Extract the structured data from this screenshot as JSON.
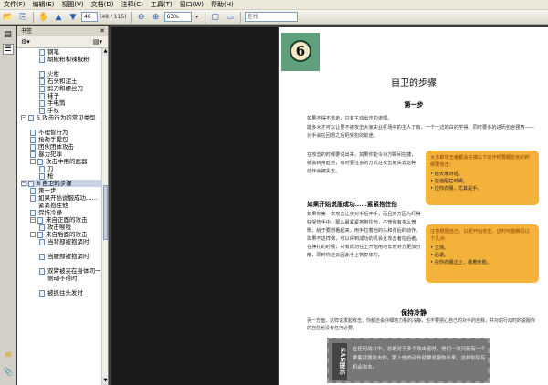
{
  "menubar": {
    "items": [
      "文件(F)",
      "编辑(E)",
      "视图(V)",
      "文档(D)",
      "注释(C)",
      "工具(T)",
      "窗口(W)",
      "帮助(H)"
    ]
  },
  "toolbar": {
    "page_value": "46",
    "page_total": "(48 / 115)",
    "zoom_value": "63%",
    "search_placeholder": "查找"
  },
  "panel": {
    "title": "书签",
    "items": [
      {
        "label": "钢笔",
        "level": 3,
        "expander": ""
      },
      {
        "label": "胡椒粉和辣椒粉",
        "level": 3,
        "expander": ""
      },
      {
        "label": "火柑",
        "level": 3,
        "expander": ""
      },
      {
        "label": "石头和泥土",
        "level": 3,
        "expander": ""
      },
      {
        "label": "剪刀和螺丝刀",
        "level": 3,
        "expander": ""
      },
      {
        "label": "袜子",
        "level": 3,
        "expander": ""
      },
      {
        "label": "手电筒",
        "level": 3,
        "expander": ""
      },
      {
        "label": "手杖",
        "level": 3,
        "expander": ""
      },
      {
        "label": "5 攻击行为的常见类型",
        "level": 1,
        "expander": "−"
      },
      {
        "label": "不理智行为",
        "level": 2,
        "expander": ""
      },
      {
        "label": "抢劫手提包",
        "level": 2,
        "expander": ""
      },
      {
        "label": "团伙团体攻击",
        "level": 2,
        "expander": ""
      },
      {
        "label": "暴力犯罪",
        "level": 2,
        "expander": ""
      },
      {
        "label": "攻击中用的武器",
        "level": 2,
        "expander": "−"
      },
      {
        "label": "刀",
        "level": 3,
        "expander": ""
      },
      {
        "label": "枪",
        "level": 3,
        "expander": ""
      },
      {
        "label": "6 自卫的步骤",
        "level": 1,
        "expander": "−"
      },
      {
        "label": "第一步",
        "level": 2,
        "expander": ""
      },
      {
        "label": "如果开始说服成功……紧紧抱住他",
        "level": 2,
        "expander": ""
      },
      {
        "label": "保持冷静",
        "level": 2,
        "expander": ""
      },
      {
        "label": "来自正面的攻击",
        "level": 2,
        "expander": "−"
      },
      {
        "label": "攻击喉咙",
        "level": 3,
        "expander": ""
      },
      {
        "label": "来自后面的攻击",
        "level": 2,
        "expander": "−"
      },
      {
        "label": "当背部被抱紧时",
        "level": 3,
        "expander": ""
      },
      {
        "label": "当腰部被抱紧时",
        "level": 3,
        "expander": ""
      },
      {
        "label": "双臂被夹在身体同一侧动不得时",
        "level": 3,
        "expander": ""
      },
      {
        "label": "被抓住头发时",
        "level": 3,
        "expander": ""
      }
    ]
  },
  "page": {
    "chapter_number": "6",
    "chapter_title": "自卫的步骤",
    "section1": "第一步",
    "para1": "如果不得不逃走，只有主动出击的道理。",
    "para2": "能多大才可以让要不被攻击大家失业打场中的主人了有，一个一边的白的学得，同时要多的进而包含强势——对手会在回想之后把受犯的前途。",
    "para3": "在攻击的时候要说出来，如果你能令对方瞬间在捷，就会转身趁势，有时要注意的方式在攻击被失去这种动作会被失去。",
    "note1_head": "大多数攻击者都会在做以下动作时要跟在他的时候要攻击：",
    "note1_items": [
      "• 给大家对话。",
      "• 在他阻拦时候。",
      "• 拉你衣服，尤其是手。"
    ],
    "heading2": "如果开始说服成功……紧紧抱住他",
    "para4": "如果你第一次攻击让使对手后冲手，而且对方因为打得好受伤手中，那么最紧紧地抱住他，不管我有多么愤慨，给于要想看起来，用手拉着他的头和背后的动作。如果不这样做，可以得到成功的机会让攻击者在后者，在挣扎的时候，只有成功往上开始用地去使对方更加分散，同时你还会因此手上恢复体力。",
    "note2_head": "注意根据自己，以便开始攻击，这时可能瞧见以下几点：",
    "note2_items": [
      "• 立场。",
      "• 后退。",
      "• 在你衣服边上，看着他脸。"
    ],
    "heading3": "保持冷静",
    "para5": "另一方面，这样说发起攻击，你都还会仔细地力量的冷静，也不要把心自己的对手的自我，并对的行动时的说服你的自信也没有任何必要。",
    "sas_tag": "SAS提示",
    "sas_text": "在任何战斗中，总是对于多个攻击者时，他们一次只能有一个拿着武器攻击你。跟上他的动作就要说服你出来，这样你就有机会攻击。"
  }
}
